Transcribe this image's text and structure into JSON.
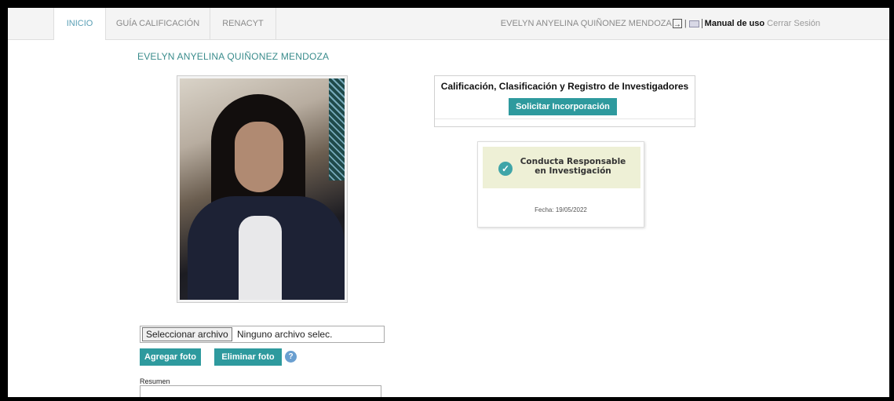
{
  "nav": {
    "tabs": [
      {
        "label": "INICIO"
      },
      {
        "label": "GUÍA CALIFICACIÓN"
      },
      {
        "label": "RENACYT"
      }
    ],
    "user_name": "EVELYN ANYELINA QUIÑONEZ MENDOZA",
    "manual_label": "Manual de uso",
    "logout_label": "Cerrar Sesión"
  },
  "profile": {
    "name": "EVELYN ANYELINA QUIÑONEZ MENDOZA",
    "file_button_label": "Seleccionar archivo",
    "file_status": "Ninguno archivo selec.",
    "add_photo_label": "Agregar foto",
    "delete_photo_label": "Eliminar foto",
    "resumen_label": "Resumen"
  },
  "calificacion": {
    "title": "Calificación, Clasificación y Registro de Investigadores",
    "button_label": "Solicitar Incorporación"
  },
  "conducta": {
    "title_line1": "Conducta Responsable",
    "title_line2": "en Investigación",
    "fecha": "Fecha: 19/05/2022"
  },
  "colors": {
    "accent": "#2e9a9e",
    "tab_active": "#5a9fb5",
    "name": "#3a8c8c",
    "banner": "#eef0d6"
  },
  "icons": [
    "logout-icon",
    "mail-icon",
    "help-icon",
    "check-icon"
  ]
}
